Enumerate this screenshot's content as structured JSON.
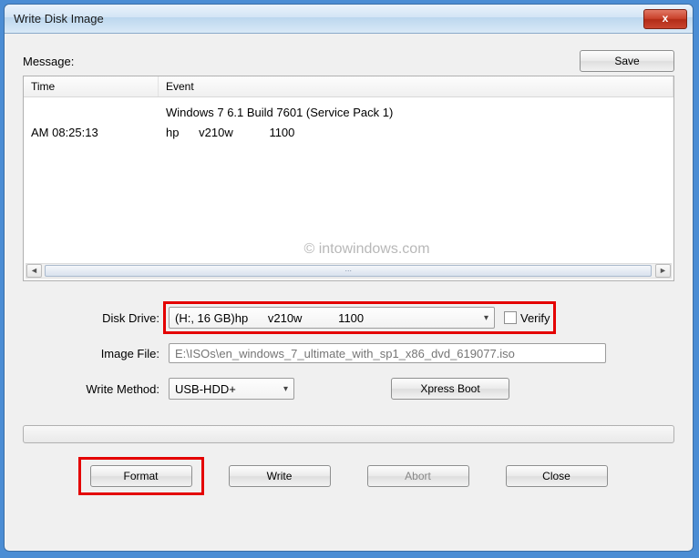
{
  "window": {
    "title": "Write Disk Image",
    "close_glyph": "x"
  },
  "top": {
    "message_label": "Message:",
    "save_label": "Save"
  },
  "listview": {
    "headers": {
      "time": "Time",
      "event": "Event"
    },
    "rows": [
      {
        "time": "",
        "event": "Windows 7 6.1 Build 7601 (Service Pack 1)"
      },
      {
        "time": "AM 08:25:13",
        "event": "hp      v210w           1100"
      }
    ],
    "scroll_thumb_glyph": "∙∙∙"
  },
  "watermark": "© intowindows.com",
  "form": {
    "disk_drive_label": "Disk Drive:",
    "disk_drive_value": "(H:, 16 GB)hp      v210w           1100",
    "verify_label": "Verify",
    "verify_checked": false,
    "image_file_label": "Image File:",
    "image_file_value": "E:\\ISOs\\en_windows_7_ultimate_with_sp1_x86_dvd_619077.iso",
    "write_method_label": "Write Method:",
    "write_method_value": "USB-HDD+",
    "xpress_boot_label": "Xpress Boot"
  },
  "buttons": {
    "format": "Format",
    "write": "Write",
    "abort": "Abort",
    "close": "Close"
  }
}
